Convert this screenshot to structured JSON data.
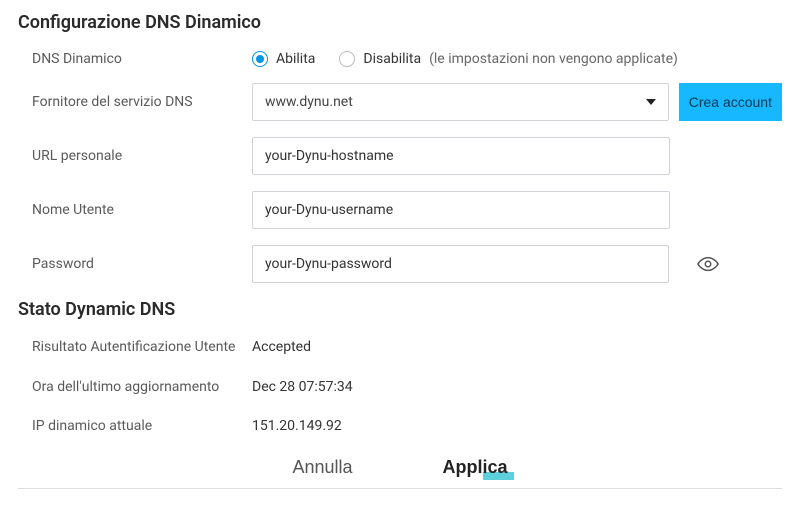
{
  "config": {
    "title": "Configurazione DNS Dinamico",
    "fields": {
      "ddns": {
        "label": "DNS Dinamico",
        "enable": "Abilita",
        "disable": "Disabilita",
        "disable_note": "(le impostazioni non vengono applicate)"
      },
      "provider": {
        "label": "Fornitore del servizio DNS",
        "value": "www.dynu.net",
        "create_btn": "Crea account"
      },
      "url": {
        "label": "URL personale",
        "value": "your-Dynu-hostname"
      },
      "username": {
        "label": "Nome Utente",
        "value": "your-Dynu-username"
      },
      "password": {
        "label": "Password",
        "value": "your-Dynu-password"
      }
    }
  },
  "status": {
    "title": "Stato Dynamic DNS",
    "auth": {
      "label": "Risultato Autentificazione Utente",
      "value": "Accepted"
    },
    "last_update": {
      "label": "Ora dell'ultimo aggiornamento",
      "value": "Dec 28 07:57:34"
    },
    "current_ip": {
      "label": "IP dinamico attuale",
      "value": "151.20.149.92"
    }
  },
  "footer": {
    "cancel": "Annulla",
    "apply": "Applica"
  }
}
